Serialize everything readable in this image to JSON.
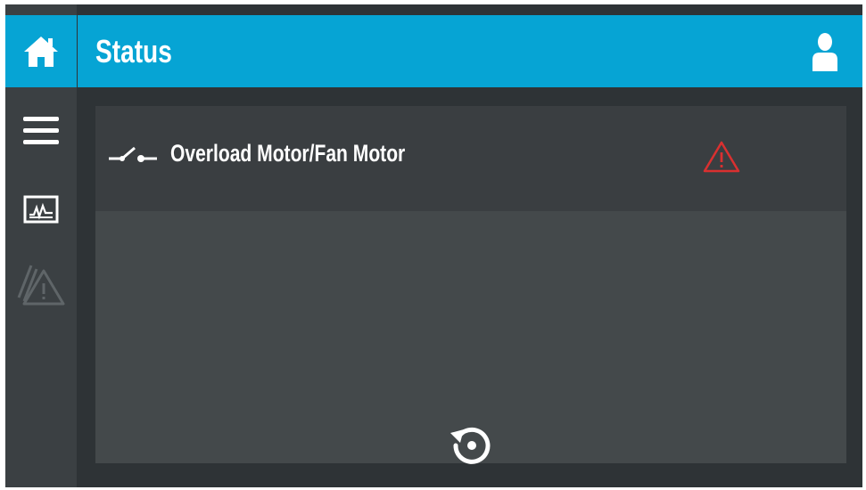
{
  "header": {
    "title": "Status",
    "accent_color": "#06a4d4",
    "user_icon": "user-icon"
  },
  "sidebar": {
    "items": [
      {
        "name": "home",
        "icon": "home-icon",
        "active": true
      },
      {
        "name": "menu",
        "icon": "hamburger-menu-icon",
        "active": false
      },
      {
        "name": "trend",
        "icon": "chart-monitor-icon",
        "active": false
      },
      {
        "name": "alarms",
        "icon": "multiple-alarms-icon",
        "active": false,
        "disabled": true
      }
    ]
  },
  "alarms": [
    {
      "label": "Overload Motor/Fan Motor",
      "icon": "open-switch-icon",
      "status_icon": "warning-triangle-icon",
      "status_color": "#d93030"
    }
  ],
  "footer": {
    "reset_icon": "reset-icon"
  }
}
